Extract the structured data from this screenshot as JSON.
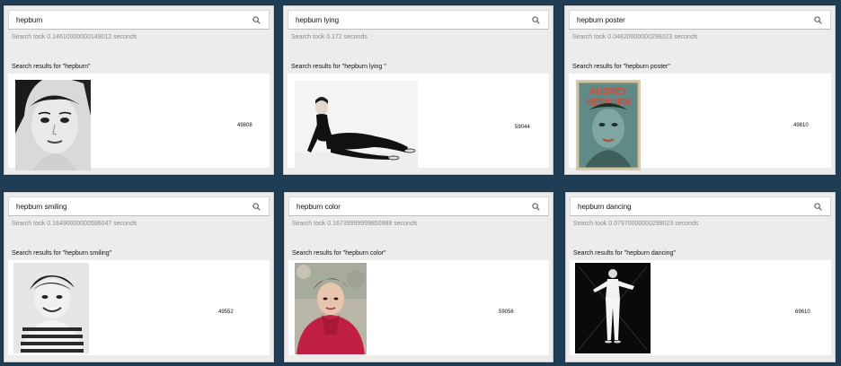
{
  "panels": [
    {
      "query": "hepburn",
      "query_keyword": "hepburn",
      "query_rest": "",
      "timing": "Search took 0.14610000000149012 seconds",
      "results_label": "Search results for \"hepburn\"",
      "result_id": "49808",
      "image": "portrait-headshot-bw"
    },
    {
      "query": "hepburn lying",
      "query_keyword": "hepburn",
      "query_rest": " lying",
      "timing": "Search took 0.172 seconds",
      "results_label": "Search results for \"hepburn lying \"",
      "result_id": "59044",
      "image": "reclining-pose-bw"
    },
    {
      "query": "hepburn poster",
      "query_keyword": "hepburn",
      "query_rest": " poster",
      "timing": "Search took 0.04820000000298023 seconds",
      "results_label": "Search results for \"hepburn poster\"",
      "result_id": "49810",
      "image": "poster-teal-red",
      "poster_text_line1": "AUDREY",
      "poster_text_line2": "HEPBURN"
    },
    {
      "query": "hepburn smiling",
      "query_keyword": "hepburn",
      "query_rest": " smiling",
      "timing": "Search took 0.16490000000596047 seconds",
      "results_label": "Search results for \"hepburn smiling\"",
      "result_id": "49552",
      "image": "smiling-striped-bw"
    },
    {
      "query": "hepburn color",
      "query_keyword": "hepburn",
      "query_rest": " color",
      "timing": "Search took 0.16739999999850988 seconds",
      "results_label": "Search results for \"hepburn color\"",
      "result_id": "59056",
      "image": "color-red-portrait"
    },
    {
      "query": "hepburn dancing",
      "query_keyword": "hepburn",
      "query_rest": " dancing",
      "timing": "Search took 0.07970000000298023 seconds",
      "results_label": "Search results for \"hepburn dancing\"",
      "result_id": "69610",
      "image": "dancing-black-bg"
    }
  ],
  "colors": {
    "background": "#1f3d54",
    "panel": "#ececec",
    "results_bg": "#ffffff",
    "timing_text": "#8a8a8a",
    "spellcheck_underline": "#d33333"
  },
  "icons": {
    "search": "search-icon"
  }
}
